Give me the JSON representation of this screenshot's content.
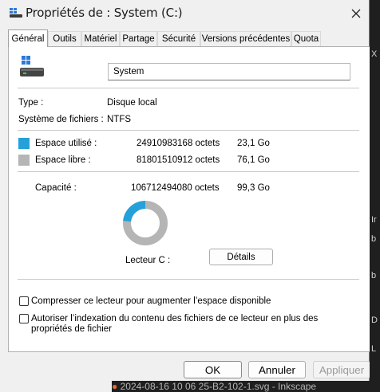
{
  "window": {
    "title": "Propriétés de : System (C:)",
    "close_icon": "close-icon",
    "title_icon": "drive-icon"
  },
  "tabs": [
    {
      "label": "Général",
      "active": true
    },
    {
      "label": "Outils"
    },
    {
      "label": "Matériel"
    },
    {
      "label": "Partage"
    },
    {
      "label": "Sécurité"
    },
    {
      "label": "Versions précédentes"
    },
    {
      "label": "Quota"
    }
  ],
  "general": {
    "drive_name": "System",
    "type_label": "Type :",
    "type_value": "Disque local",
    "fs_label": "Système de fichiers :",
    "fs_value": "NTFS",
    "used": {
      "label": "Espace utilisé :",
      "bytes": "24910983168 octets",
      "size": "23,1 Go",
      "color": "#26a0da"
    },
    "free": {
      "label": "Espace libre :",
      "bytes": "81801510912 octets",
      "size": "76,1 Go",
      "color": "#b5b5b5"
    },
    "capacity": {
      "label": "Capacité :",
      "bytes": "106712494080 octets",
      "size": "99,3 Go"
    },
    "used_fraction": 0.233,
    "drive_letter_label": "Lecteur C :",
    "details_button": "Détails",
    "compress_label": "Compresser ce lecteur pour augmenter l’espace disponible",
    "compress_checked": false,
    "index_label": "Autoriser l’indexation du contenu des fichiers de ce lecteur en plus des propriétés de fichier",
    "index_checked": false
  },
  "footer": {
    "ok": "OK",
    "cancel": "Annuler",
    "apply": "Appliquer"
  },
  "background": {
    "taskbar_text": "2024-08-16 10 06 25-B2-102-1.svg - Inkscape",
    "side_chars": [
      "X",
      "Ir",
      "b",
      "b",
      "D",
      "L"
    ]
  }
}
